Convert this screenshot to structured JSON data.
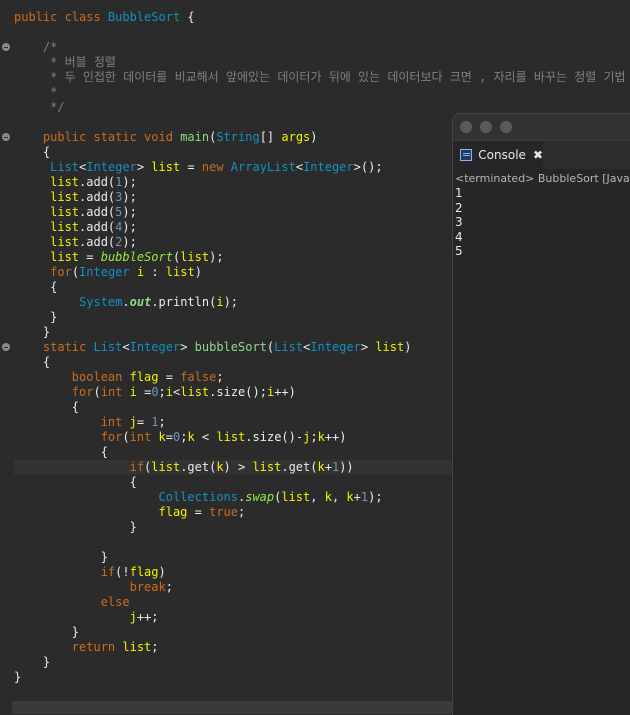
{
  "code_lines": [
    "public class BubbleSort {",
    "",
    "    /*",
    "     * 버블 정렬",
    "     * 두 인접한 데이터를 비교해서 앞에있는 데이터가 뒤에 있는 데이터보다 크면 , 자리를 바꾸는 정렬 기법",
    "     *",
    "     */",
    "",
    "    public static void main(String[] args)",
    "    {",
    "     List<Integer> list = new ArrayList<Integer>();",
    "     list.add(1);",
    "     list.add(3);",
    "     list.add(5);",
    "     list.add(4);",
    "     list.add(2);",
    "     list = bubbleSort(list);",
    "     for(Integer i : list)",
    "     {",
    "         System.out.println(i);",
    "     }",
    "    }",
    "    static List<Integer> bubbleSort(List<Integer> list)",
    "    {",
    "        boolean flag = false;",
    "        for(int i =0;i<list.size();i++)",
    "        {",
    "            int j= 1;",
    "            for(int k=0;k < list.size()-j;k++)",
    "            {",
    "                if(list.get(k) > list.get(k+1))",
    "                {",
    "                    Collections.swap(list, k, k+1);",
    "                    flag = true;",
    "                }",
    "",
    "            }",
    "            if(!flag)",
    "                break;",
    "            else",
    "                j++;",
    "        }",
    "        return list;",
    "    }",
    "}"
  ],
  "console": {
    "tab_label": "Console",
    "close_glyph": "✖",
    "status": "<terminated> BubbleSort [Java Application]",
    "output": [
      "1",
      "2",
      "3",
      "4",
      "5"
    ]
  },
  "colors": {
    "keyword": "#cc6c1d",
    "class": "#1290c3",
    "variable": "#f2f200",
    "comment": "#808080",
    "background": "#2b2b2b"
  }
}
